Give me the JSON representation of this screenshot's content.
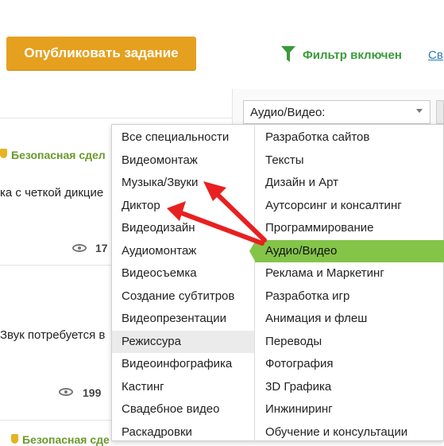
{
  "header": {
    "publish_label": "Опубликовать задание",
    "filter_label": "Фильтр включен",
    "filter_link": "Св"
  },
  "tasks": [
    {
      "badge": "Безопасная сдел",
      "text": "ка с четкой дикцие",
      "views": "17"
    },
    {
      "badge": "",
      "text": "Звук потребуется в",
      "views": "199"
    },
    {
      "badge": "Безопасная сде",
      "text": "",
      "views": ""
    }
  ],
  "filter_select": {
    "value": "Аудио/Видео:"
  },
  "dropdown": {
    "specialties": [
      "Все специальности",
      "Видеомонтаж",
      "Музыка/Звуки",
      "Диктор",
      "Видеодизайн",
      "Аудиомонтаж",
      "Видеосъемка",
      "Создание субтитров",
      "Видеопрезентации",
      "Режиссура",
      "Видеоинфографика",
      "Кастинг",
      "Свадебное видео",
      "Раскадровки"
    ],
    "categories": [
      "Разработка сайтов",
      "Тексты",
      "Дизайн и Арт",
      "Аутсорсинг и консалтинг",
      "Программирование",
      "Аудио/Видео",
      "Реклама и Маркетинг",
      "Разработка игр",
      "Анимация и флеш",
      "Переводы",
      "Фотография",
      "3D Графика",
      "Инжиниринг",
      "Обучение и консультации"
    ],
    "hovered_specialty": "Режиссура",
    "selected_category": "Аудио/Видео"
  },
  "colors": {
    "publish_button": "#e6a01f",
    "accent_green": "#84c449",
    "filter_text": "#3a9a3a",
    "annotation_arrow": "#e82020"
  }
}
